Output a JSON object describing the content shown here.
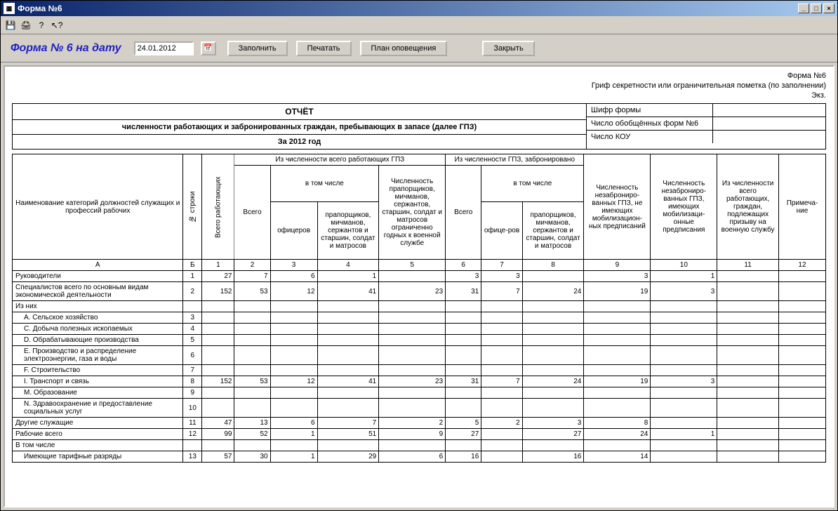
{
  "window": {
    "title": "Форма №6"
  },
  "controls": {
    "title": "Форма № 6 на дату",
    "date": "24.01.2012",
    "fill": "Заполнить",
    "print": "Печатать",
    "plan": "План оповещения",
    "close": "Закрыть"
  },
  "meta": {
    "form_no": "Форма №6",
    "secrecy": "Гриф секретности или ограничительная пометка (по заполнении)",
    "copy": "Экз."
  },
  "report": {
    "title": "ОТЧЁТ",
    "subtitle": "численности работающих и забронированных граждан, пребывающих в запасе (далее ГПЗ)",
    "year": "За 2012 год"
  },
  "right_box": {
    "r1": "Шифр формы",
    "r2": "Число обобщённых форм №6",
    "r3": "Число КОУ"
  },
  "headers": {
    "name": "Наименование категорий должностей служащих и профессий рабочих",
    "rownum": "№ строки",
    "total_work": "Всего работающих",
    "grp_total_gpz": "Из численности всего работающих ГПЗ",
    "grp_reserved": "Из численности ГПЗ, забронировано",
    "all": "Всего",
    "incl": "в том числе",
    "officers": "офицеров",
    "prapor": "прапорщиков, мичманов, сержантов и старшин, солдат и матросов",
    "limited": "Численность прапорщиков, мичманов, сержантов, старшин, солдат и матросов ограниченно годных к военной службе",
    "officers2": "офице-ров",
    "no_mob": "Численность незаброниро-ванных ГПЗ, не имеющих мобилизацион-ных предписаний",
    "has_mob": "Численность незаброниро-ванных ГПЗ, имеющих мобилизаци-онные предписания",
    "draft": "Из численности всего работающих, граждан, подлежащих призыву на военную службу",
    "note": "Примеча-ние",
    "colA": "А",
    "colB": "Б"
  },
  "rows": [
    {
      "name": "Руководители",
      "n": "1",
      "c1": "27",
      "c2": "7",
      "c3": "6",
      "c4": "1",
      "c5": "",
      "c6": "3",
      "c7": "3",
      "c8": "",
      "c9": "3",
      "c10": "1",
      "c11": "",
      "c12": "",
      "indent": false
    },
    {
      "name": "Специалистов всего по основным видам экономической деятельности",
      "n": "2",
      "c1": "152",
      "c2": "53",
      "c3": "12",
      "c4": "41",
      "c5": "23",
      "c6": "31",
      "c7": "7",
      "c8": "24",
      "c9": "19",
      "c10": "3",
      "c11": "",
      "c12": "",
      "indent": false
    },
    {
      "name": "Из них",
      "n": "",
      "c1": "",
      "c2": "",
      "c3": "",
      "c4": "",
      "c5": "",
      "c6": "",
      "c7": "",
      "c8": "",
      "c9": "",
      "c10": "",
      "c11": "",
      "c12": "",
      "indent": false
    },
    {
      "name": "А. Сельское хозяйство",
      "n": "3",
      "c1": "",
      "c2": "",
      "c3": "",
      "c4": "",
      "c5": "",
      "c6": "",
      "c7": "",
      "c8": "",
      "c9": "",
      "c10": "",
      "c11": "",
      "c12": "",
      "indent": true
    },
    {
      "name": "С. Добыча полезных ископаемых",
      "n": "4",
      "c1": "",
      "c2": "",
      "c3": "",
      "c4": "",
      "c5": "",
      "c6": "",
      "c7": "",
      "c8": "",
      "c9": "",
      "c10": "",
      "c11": "",
      "c12": "",
      "indent": true
    },
    {
      "name": "D. Обрабатывающие производства",
      "n": "5",
      "c1": "",
      "c2": "",
      "c3": "",
      "c4": "",
      "c5": "",
      "c6": "",
      "c7": "",
      "c8": "",
      "c9": "",
      "c10": "",
      "c11": "",
      "c12": "",
      "indent": true
    },
    {
      "name": "Е. Производство и распределение электроэнергии, газа и воды",
      "n": "6",
      "c1": "",
      "c2": "",
      "c3": "",
      "c4": "",
      "c5": "",
      "c6": "",
      "c7": "",
      "c8": "",
      "c9": "",
      "c10": "",
      "c11": "",
      "c12": "",
      "indent": true
    },
    {
      "name": "F. Строительство",
      "n": "7",
      "c1": "",
      "c2": "",
      "c3": "",
      "c4": "",
      "c5": "",
      "c6": "",
      "c7": "",
      "c8": "",
      "c9": "",
      "c10": "",
      "c11": "",
      "c12": "",
      "indent": true
    },
    {
      "name": "I. Транспорт и связь",
      "n": "8",
      "c1": "152",
      "c2": "53",
      "c3": "12",
      "c4": "41",
      "c5": "23",
      "c6": "31",
      "c7": "7",
      "c8": "24",
      "c9": "19",
      "c10": "3",
      "c11": "",
      "c12": "",
      "indent": true
    },
    {
      "name": "М. Образование",
      "n": "9",
      "c1": "",
      "c2": "",
      "c3": "",
      "c4": "",
      "c5": "",
      "c6": "",
      "c7": "",
      "c8": "",
      "c9": "",
      "c10": "",
      "c11": "",
      "c12": "",
      "indent": true
    },
    {
      "name": "N. Здравоохранение и предоставление социальных услуг",
      "n": "10",
      "c1": "",
      "c2": "",
      "c3": "",
      "c4": "",
      "c5": "",
      "c6": "",
      "c7": "",
      "c8": "",
      "c9": "",
      "c10": "",
      "c11": "",
      "c12": "",
      "indent": true
    },
    {
      "name": "Другие служащие",
      "n": "11",
      "c1": "47",
      "c2": "13",
      "c3": "6",
      "c4": "7",
      "c5": "2",
      "c6": "5",
      "c7": "2",
      "c8": "3",
      "c9": "8",
      "c10": "",
      "c11": "",
      "c12": "",
      "indent": false
    },
    {
      "name": "Рабочие всего",
      "n": "12",
      "c1": "99",
      "c2": "52",
      "c3": "1",
      "c4": "51",
      "c5": "9",
      "c6": "27",
      "c7": "",
      "c8": "27",
      "c9": "24",
      "c10": "1",
      "c11": "",
      "c12": "",
      "indent": false
    },
    {
      "name": "В том числе",
      "n": "",
      "c1": "",
      "c2": "",
      "c3": "",
      "c4": "",
      "c5": "",
      "c6": "",
      "c7": "",
      "c8": "",
      "c9": "",
      "c10": "",
      "c11": "",
      "c12": "",
      "indent": false
    },
    {
      "name": "Имеющие тарифные разряды",
      "n": "13",
      "c1": "57",
      "c2": "30",
      "c3": "1",
      "c4": "29",
      "c5": "6",
      "c6": "16",
      "c7": "",
      "c8": "16",
      "c9": "14",
      "c10": "",
      "c11": "",
      "c12": "",
      "indent": true
    }
  ]
}
